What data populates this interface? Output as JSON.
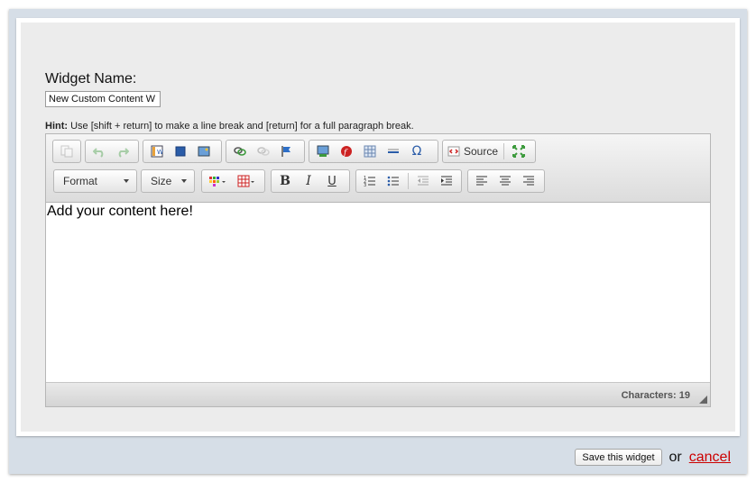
{
  "form": {
    "widget_name_label": "Widget Name:",
    "widget_name_value": "New Custom Content W",
    "hint_label": "Hint:",
    "hint_text": " Use [shift + return] to make a line break and [return] for a full paragraph break."
  },
  "editor": {
    "toolbar": {
      "source_label": "Source",
      "format_label": "Format",
      "size_label": "Size"
    },
    "content": "Add your content here!",
    "status": {
      "characters": "Characters: 19"
    }
  },
  "footer": {
    "save_label": "Save this widget",
    "or_text": "or",
    "cancel_label": "cancel"
  },
  "colors": {
    "cancel_link": "#cc0000",
    "window_bg": "#d6dee7"
  }
}
